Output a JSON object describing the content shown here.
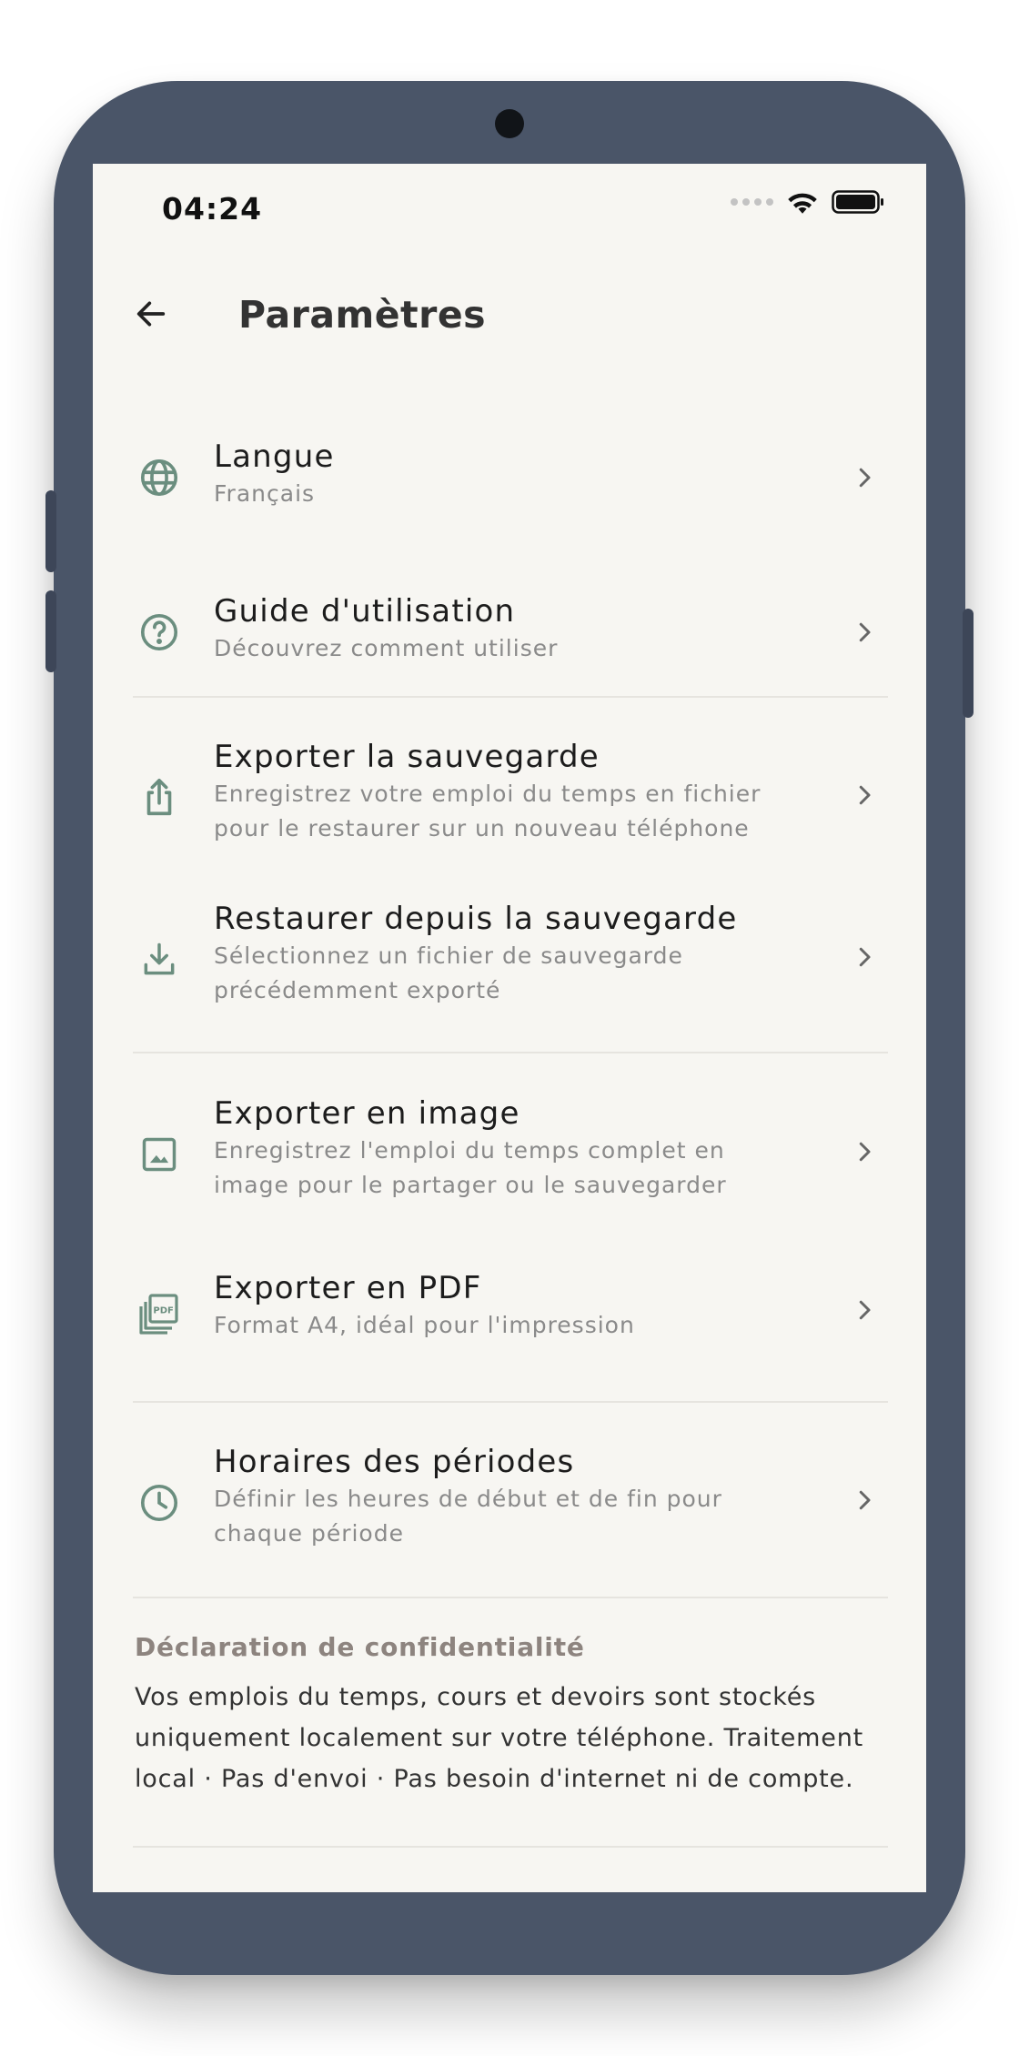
{
  "status_bar": {
    "time": "04:24",
    "icons": [
      "signal-dots-icon",
      "wifi-icon",
      "battery-icon"
    ]
  },
  "app_bar": {
    "back_icon": "arrow-left-icon",
    "title": "Paramètres"
  },
  "settings": [
    {
      "id": "language",
      "icon": "globe-icon",
      "title": "Langue",
      "subtitle": "Français"
    },
    {
      "id": "guide",
      "icon": "help-circle-icon",
      "title": "Guide d'utilisation",
      "subtitle": "Découvrez comment utiliser"
    },
    {
      "id": "export-backup",
      "icon": "share-upload-icon",
      "title": "Exporter la sauvegarde",
      "subtitle": "Enregistrez votre emploi du temps en fichier pour le restaurer sur un nouveau téléphone"
    },
    {
      "id": "restore-backup",
      "icon": "download-icon",
      "title": "Restaurer depuis la sauvegarde",
      "subtitle": "Sélectionnez un fichier de sauvegarde précédemment exporté"
    },
    {
      "id": "export-image",
      "icon": "image-icon",
      "title": "Exporter en image",
      "subtitle": "Enregistrez l'emploi du temps complet en image pour le partager ou le sauvegarder"
    },
    {
      "id": "export-pdf",
      "icon": "pdf-icon",
      "title": "Exporter en PDF",
      "subtitle": "Format A4, idéal pour l'impression"
    },
    {
      "id": "period-times",
      "icon": "clock-icon",
      "title": "Horaires des périodes",
      "subtitle": "Définir les heures de début et de fin pour chaque période"
    }
  ],
  "privacy": {
    "title": "Déclaration de confidentialité",
    "body": "Vos emplois du temps, cours et devoirs sont stockés uniquement localement sur votre téléphone. Traitement local · Pas d'envoi · Pas besoin d'internet ni de compte."
  },
  "colors": {
    "frame": "#4a5568",
    "screen_bg": "#f7f6f2",
    "icon_green": "#6b8e7f",
    "title_text": "#1c1c1c",
    "subtitle_text": "#8a8a8a",
    "section_label": "#8d847f"
  }
}
